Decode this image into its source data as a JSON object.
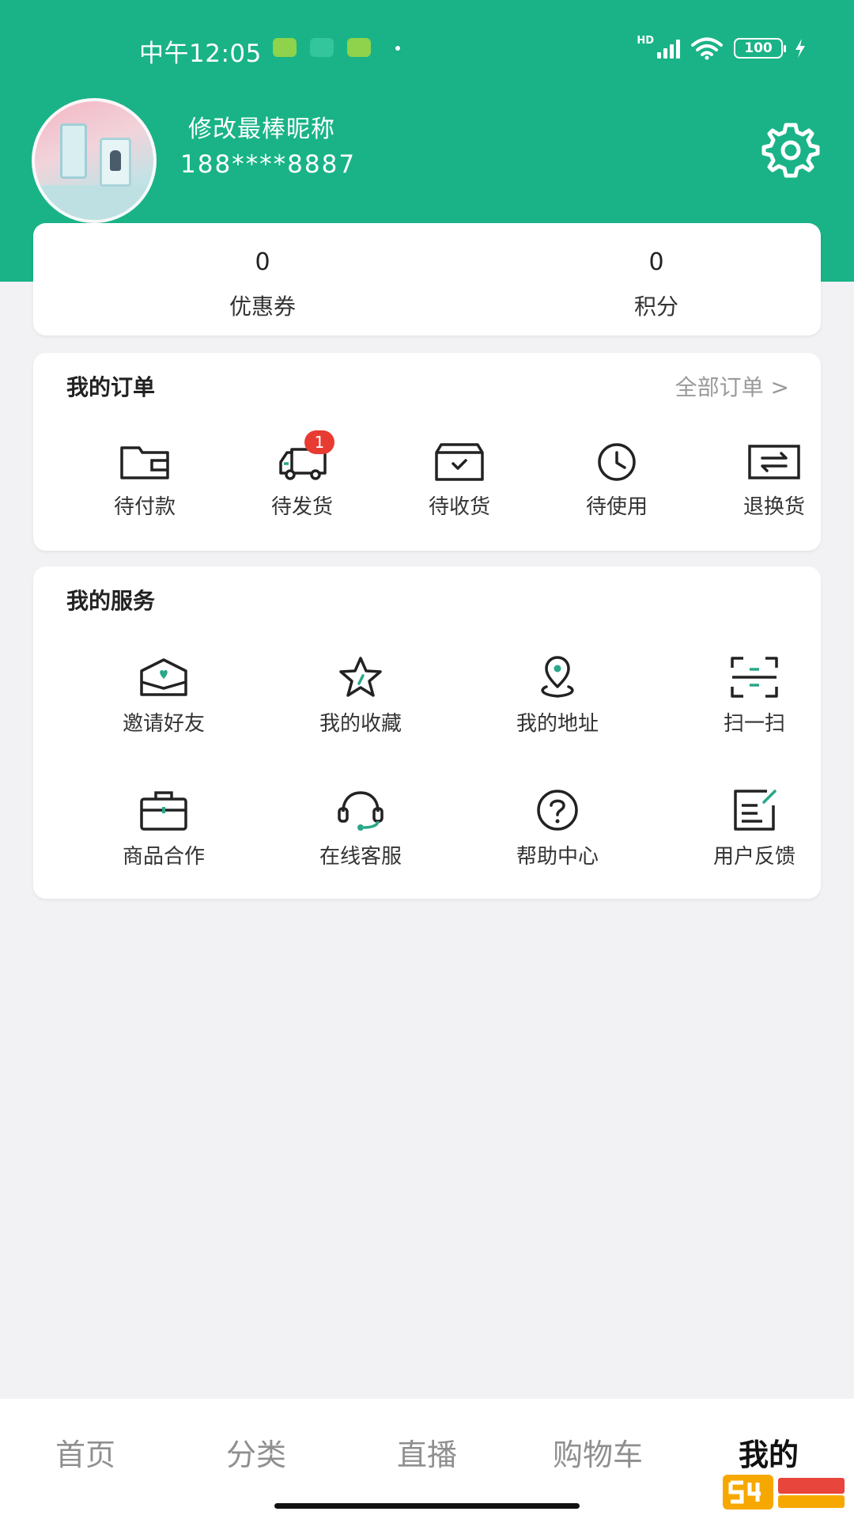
{
  "status_bar": {
    "time": "中午12:05",
    "network_label": "HD",
    "battery": "100"
  },
  "profile": {
    "nickname": "修改最棒昵称",
    "phone": "188****8887"
  },
  "stats": {
    "coupon_count": "0",
    "coupon_label": "优惠券",
    "points_count": "0",
    "points_label": "积分"
  },
  "orders": {
    "title": "我的订单",
    "all_link": "全部订单 >",
    "items": [
      {
        "label": "待付款",
        "icon": "wallet-icon"
      },
      {
        "label": "待发货",
        "icon": "truck-icon",
        "badge": "1"
      },
      {
        "label": "待收货",
        "icon": "package-icon"
      },
      {
        "label": "待使用",
        "icon": "clock-icon"
      },
      {
        "label": "退换货",
        "icon": "exchange-icon"
      }
    ]
  },
  "services": {
    "title": "我的服务",
    "items": [
      {
        "label": "邀请好友",
        "icon": "envelope-heart-icon"
      },
      {
        "label": "我的收藏",
        "icon": "star-icon"
      },
      {
        "label": "我的地址",
        "icon": "location-pin-icon"
      },
      {
        "label": "扫一扫",
        "icon": "scan-icon"
      },
      {
        "label": "商品合作",
        "icon": "briefcase-icon"
      },
      {
        "label": "在线客服",
        "icon": "headset-icon"
      },
      {
        "label": "帮助中心",
        "icon": "help-icon"
      },
      {
        "label": "用户反馈",
        "icon": "feedback-icon"
      }
    ]
  },
  "bottom_nav": [
    {
      "label": "首页"
    },
    {
      "label": "分类"
    },
    {
      "label": "直播"
    },
    {
      "label": "购物车"
    },
    {
      "label": "我的",
      "active": true
    }
  ],
  "colors": {
    "brand": "#19b387",
    "badge": "#e83b32",
    "accent_icon": "#2aa78a",
    "background": "#f2f2f4"
  }
}
